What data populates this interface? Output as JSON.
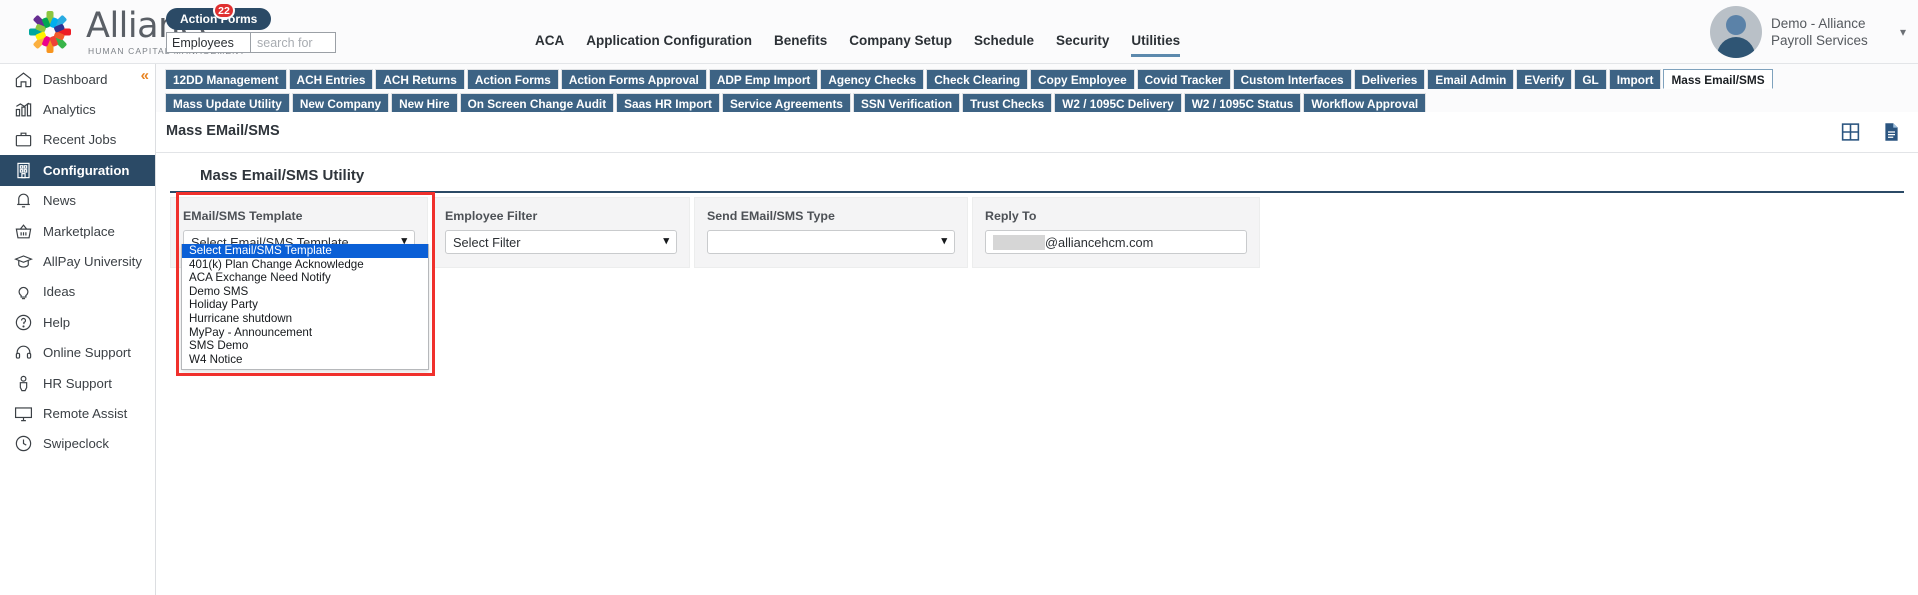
{
  "brand": {
    "name": "Alliance",
    "tagline": "HUMAN CAPITAL MANAGEMENT",
    "accent": "#2b4a66",
    "tab_color": "#3d6384",
    "badge_color": "#e03030",
    "highlight_color": "#f0302c"
  },
  "header": {
    "action_forms_label": "Action Forms",
    "action_forms_badge": "22",
    "search": {
      "selected_scope": "Employees",
      "scope_options": [
        "Employees"
      ],
      "placeholder": "search for",
      "value": ""
    },
    "nav": [
      {
        "label": "ACA",
        "active": false
      },
      {
        "label": "Application Configuration",
        "active": false
      },
      {
        "label": "Benefits",
        "active": false
      },
      {
        "label": "Company Setup",
        "active": false
      },
      {
        "label": "Schedule",
        "active": false
      },
      {
        "label": "Security",
        "active": false
      },
      {
        "label": "Utilities",
        "active": true
      }
    ],
    "user": {
      "name": "Demo - Alliance Payroll Services",
      "caret": "chevron-down-icon"
    }
  },
  "sidebar": {
    "collapse_glyph": "«",
    "items": [
      {
        "label": "Dashboard",
        "icon": "home-icon",
        "active": false
      },
      {
        "label": "Analytics",
        "icon": "chart-icon",
        "active": false
      },
      {
        "label": "Recent Jobs",
        "icon": "briefcase-icon",
        "active": false
      },
      {
        "label": "Configuration",
        "icon": "building-icon",
        "active": true
      },
      {
        "label": "News",
        "icon": "bell-icon",
        "active": false
      },
      {
        "label": "Marketplace",
        "icon": "basket-icon",
        "active": false
      },
      {
        "label": "AllPay University",
        "icon": "graduation-cap-icon",
        "active": false
      },
      {
        "label": "Ideas",
        "icon": "lightbulb-icon",
        "active": false
      },
      {
        "label": "Help",
        "icon": "question-circle-icon",
        "active": false
      },
      {
        "label": "Online Support",
        "icon": "headset-icon",
        "active": false
      },
      {
        "label": "HR Support",
        "icon": "person-icon",
        "active": false
      },
      {
        "label": "Remote Assist",
        "icon": "monitor-icon",
        "active": false
      },
      {
        "label": "Swipeclock",
        "icon": "clock-icon",
        "active": false
      }
    ]
  },
  "tabs_row1": [
    {
      "label": "12DD Management",
      "active": false
    },
    {
      "label": "ACH Entries",
      "active": false
    },
    {
      "label": "ACH Returns",
      "active": false
    },
    {
      "label": "Action Forms",
      "active": false
    },
    {
      "label": "Action Forms Approval",
      "active": false
    },
    {
      "label": "ADP Emp Import",
      "active": false
    },
    {
      "label": "Agency Checks",
      "active": false
    },
    {
      "label": "Check Clearing",
      "active": false
    },
    {
      "label": "Copy Employee",
      "active": false
    },
    {
      "label": "Covid Tracker",
      "active": false
    },
    {
      "label": "Custom Interfaces",
      "active": false
    },
    {
      "label": "Deliveries",
      "active": false
    },
    {
      "label": "Email Admin",
      "active": false
    },
    {
      "label": "EVerify",
      "active": false
    },
    {
      "label": "GL",
      "active": false
    },
    {
      "label": "Import",
      "active": false
    },
    {
      "label": "Mass Email/SMS",
      "active": true
    }
  ],
  "tabs_row2": [
    {
      "label": "Mass Update Utility",
      "active": false
    },
    {
      "label": "New Company",
      "active": false
    },
    {
      "label": "New Hire",
      "active": false
    },
    {
      "label": "On Screen Change Audit",
      "active": false
    },
    {
      "label": "Saas HR Import",
      "active": false
    },
    {
      "label": "Service Agreements",
      "active": false
    },
    {
      "label": "SSN Verification",
      "active": false
    },
    {
      "label": "Trust Checks",
      "active": false
    },
    {
      "label": "W2 / 1095C Delivery",
      "active": false
    },
    {
      "label": "W2 / 1095C Status",
      "active": false
    },
    {
      "label": "Workflow Approval",
      "active": false
    }
  ],
  "page": {
    "title": "Mass EMail/SMS",
    "icons": [
      {
        "name": "grid-view-icon"
      },
      {
        "name": "document-icon"
      }
    ]
  },
  "main": {
    "section_title": "Mass Email/SMS Utility",
    "template_panel": {
      "label": "EMail/SMS Template",
      "selected": "Select Email/SMS Template",
      "open": true,
      "options": [
        "Select Email/SMS Template",
        "401(k) Plan Change Acknowledge",
        "ACA Exchange Need Notify",
        "Demo SMS",
        "Holiday Party",
        "Hurricane shutdown",
        "MyPay - Announcement",
        "SMS Demo",
        "W4 Notice"
      ],
      "highlighted_option": "Select Email/SMS Template"
    },
    "filter_panel": {
      "label": "Employee Filter",
      "selected": "Select Filter"
    },
    "type_panel": {
      "label": "Send EMail/SMS Type",
      "selected": ""
    },
    "reply_panel": {
      "label": "Reply To",
      "redacted": true,
      "value_suffix": "@alliancehcm.com"
    }
  }
}
